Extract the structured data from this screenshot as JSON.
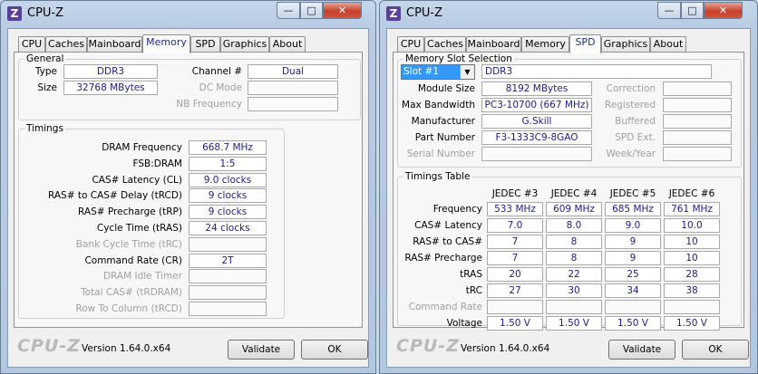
{
  "left": {
    "title": "CPU-Z",
    "app_icon": "Z",
    "tabs": [
      "CPU",
      "Caches",
      "Mainboard",
      "Memory",
      "SPD",
      "Graphics",
      "About"
    ],
    "active_tab": "Memory",
    "general": {
      "label": "General",
      "type_label": "Type",
      "type_value": "DDR3",
      "size_label": "Size",
      "size_value": "32768 MBytes",
      "channel_label": "Channel #",
      "channel_value": "Dual",
      "dcmode_label": "DC Mode",
      "dcmode_value": "",
      "nbfreq_label": "NB Frequency",
      "nbfreq_value": ""
    },
    "timings": {
      "label": "Timings",
      "rows": [
        {
          "label": "DRAM Frequency",
          "value": "668.7 MHz",
          "enabled": true
        },
        {
          "label": "FSB:DRAM",
          "value": "1:5",
          "enabled": true
        },
        {
          "label": "CAS# Latency (CL)",
          "value": "9.0 clocks",
          "enabled": true
        },
        {
          "label": "RAS# to CAS# Delay (tRCD)",
          "value": "9 clocks",
          "enabled": true
        },
        {
          "label": "RAS# Precharge (tRP)",
          "value": "9 clocks",
          "enabled": true
        },
        {
          "label": "Cycle Time (tRAS)",
          "value": "24 clocks",
          "enabled": true
        },
        {
          "label": "Bank Cycle Time (tRC)",
          "value": "",
          "enabled": false
        },
        {
          "label": "Command Rate (CR)",
          "value": "2T",
          "enabled": true
        },
        {
          "label": "DRAM Idle Timer",
          "value": "",
          "enabled": false
        },
        {
          "label": "Total CAS# (tRDRAM)",
          "value": "",
          "enabled": false
        },
        {
          "label": "Row To Column (tRCD)",
          "value": "",
          "enabled": false
        }
      ]
    },
    "footer": {
      "logo": "CPU-Z",
      "version": "Version 1.64.0.x64",
      "validate": "Validate",
      "ok": "OK"
    }
  },
  "right": {
    "title": "CPU-Z",
    "app_icon": "Z",
    "tabs": [
      "CPU",
      "Caches",
      "Mainboard",
      "Memory",
      "SPD",
      "Graphics",
      "About"
    ],
    "active_tab": "SPD",
    "slot": {
      "label": "Memory Slot Selection",
      "selected": "Slot #1",
      "type_value": "DDR3",
      "module_size_label": "Module Size",
      "module_size": "8192 MBytes",
      "max_bw_label": "Max Bandwidth",
      "max_bw": "PC3-10700 (667 MHz)",
      "manufacturer_label": "Manufacturer",
      "manufacturer": "G.Skill",
      "part_label": "Part Number",
      "part": "F3-1333C9-8GAO",
      "serial_label": "Serial Number",
      "serial": "",
      "correction_label": "Correction",
      "correction": "",
      "registered_label": "Registered",
      "registered": "",
      "buffered_label": "Buffered",
      "buffered": "",
      "spdext_label": "SPD Ext.",
      "spdext": "",
      "weekyear_label": "Week/Year",
      "weekyear": ""
    },
    "timings_table": {
      "label": "Timings Table",
      "columns": [
        "JEDEC #3",
        "JEDEC #4",
        "JEDEC #5",
        "JEDEC #6"
      ],
      "rows": [
        {
          "label": "Frequency",
          "enabled": true,
          "values": [
            "533 MHz",
            "609 MHz",
            "685 MHz",
            "761 MHz"
          ]
        },
        {
          "label": "CAS# Latency",
          "enabled": true,
          "values": [
            "7.0",
            "8.0",
            "9.0",
            "10.0"
          ]
        },
        {
          "label": "RAS# to CAS#",
          "enabled": true,
          "values": [
            "7",
            "8",
            "9",
            "10"
          ]
        },
        {
          "label": "RAS# Precharge",
          "enabled": true,
          "values": [
            "7",
            "8",
            "9",
            "10"
          ]
        },
        {
          "label": "tRAS",
          "enabled": true,
          "values": [
            "20",
            "22",
            "25",
            "28"
          ]
        },
        {
          "label": "tRC",
          "enabled": true,
          "values": [
            "27",
            "30",
            "34",
            "38"
          ]
        },
        {
          "label": "Command Rate",
          "enabled": false,
          "values": [
            "",
            "",
            "",
            ""
          ]
        },
        {
          "label": "Voltage",
          "enabled": true,
          "values": [
            "1.50 V",
            "1.50 V",
            "1.50 V",
            "1.50 V"
          ]
        }
      ]
    },
    "footer": {
      "logo": "CPU-Z",
      "version": "Version 1.64.0.x64",
      "validate": "Validate",
      "ok": "OK"
    }
  }
}
